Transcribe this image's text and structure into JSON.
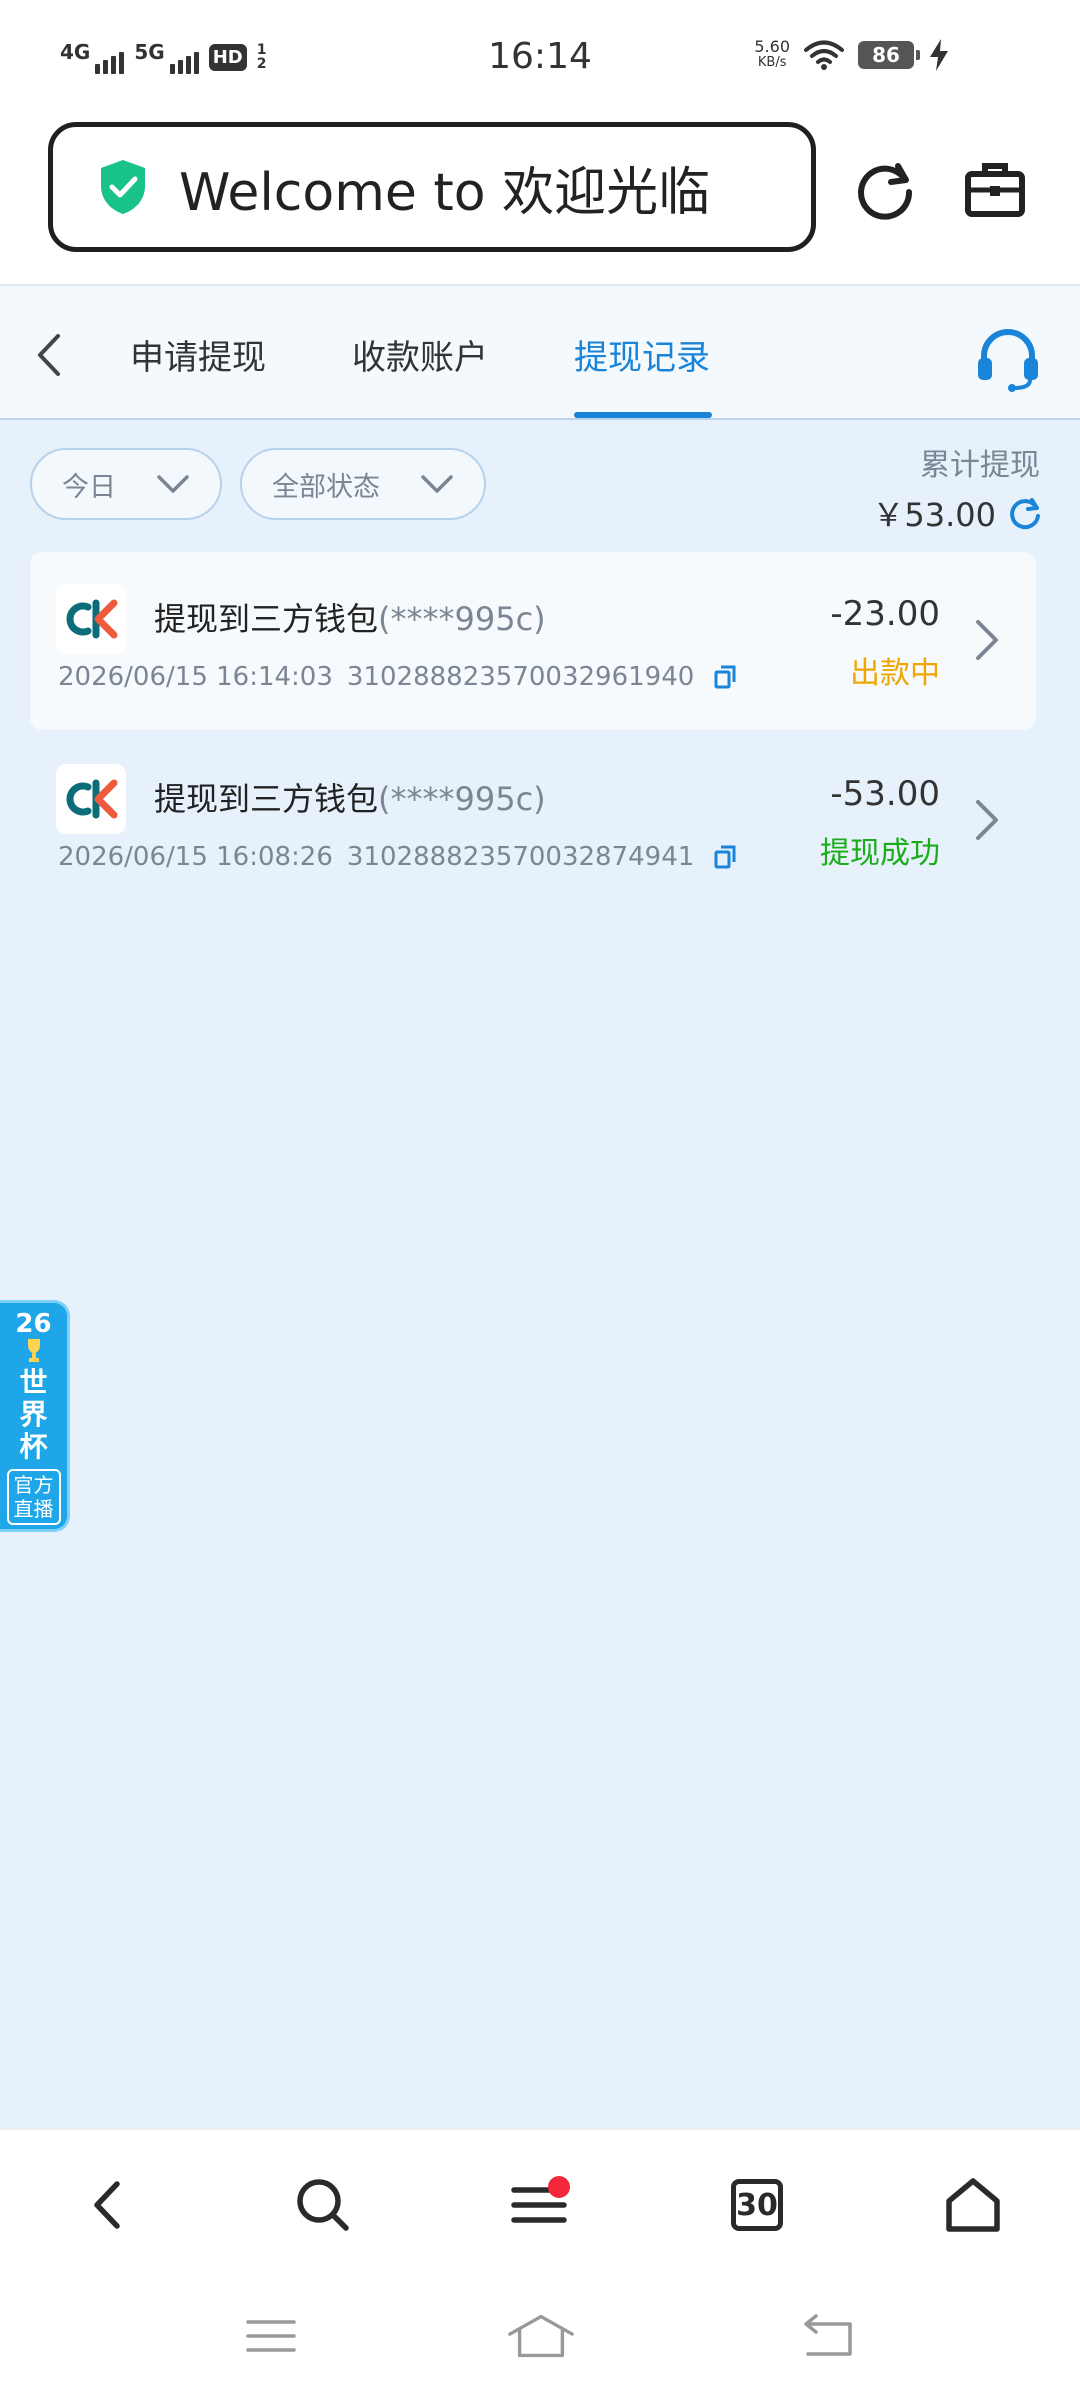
{
  "status_bar": {
    "time": "16:14",
    "network_1": "4G",
    "network_2": "5G",
    "hd_badge": "HD",
    "hd_sub": "1\n2",
    "speed_value": "5.60",
    "speed_unit": "KB/s",
    "battery": "86"
  },
  "browser": {
    "url_text": "Welcome to 欢迎光临",
    "reload_label": "reload",
    "toolbox_label": "toolbox"
  },
  "tabs": {
    "items": [
      {
        "label": "申请提现"
      },
      {
        "label": "收款账户"
      },
      {
        "label": "提现记录"
      }
    ],
    "active_index": 2
  },
  "filters": {
    "date": "今日",
    "status": "全部状态"
  },
  "summary": {
    "label": "累计提现",
    "amount": "￥53.00"
  },
  "records": [
    {
      "title": "提现到三方钱包",
      "account": "(****995c)",
      "datetime": "2026/06/15 16:14:03",
      "order_no": "310288823570032961940",
      "amount": "-23.00",
      "status": "出款中",
      "status_color": "#f0a500"
    },
    {
      "title": "提现到三方钱包",
      "account": "(****995c)",
      "datetime": "2026/06/15 16:08:26",
      "order_no": "310288823570032874941",
      "amount": "-53.00",
      "status": "提现成功",
      "status_color": "#1aad19"
    }
  ],
  "world_cup_badge": {
    "year": "26",
    "title_1": "世",
    "title_2": "界",
    "title_3": "杯",
    "sub_1": "官方",
    "sub_2": "直播"
  },
  "bottom_nav": {
    "tabs_count": "30"
  },
  "colors": {
    "accent": "#1a84d8",
    "pending": "#f0a500",
    "success": "#1aad19",
    "page_bg": "#e6f1fb"
  }
}
